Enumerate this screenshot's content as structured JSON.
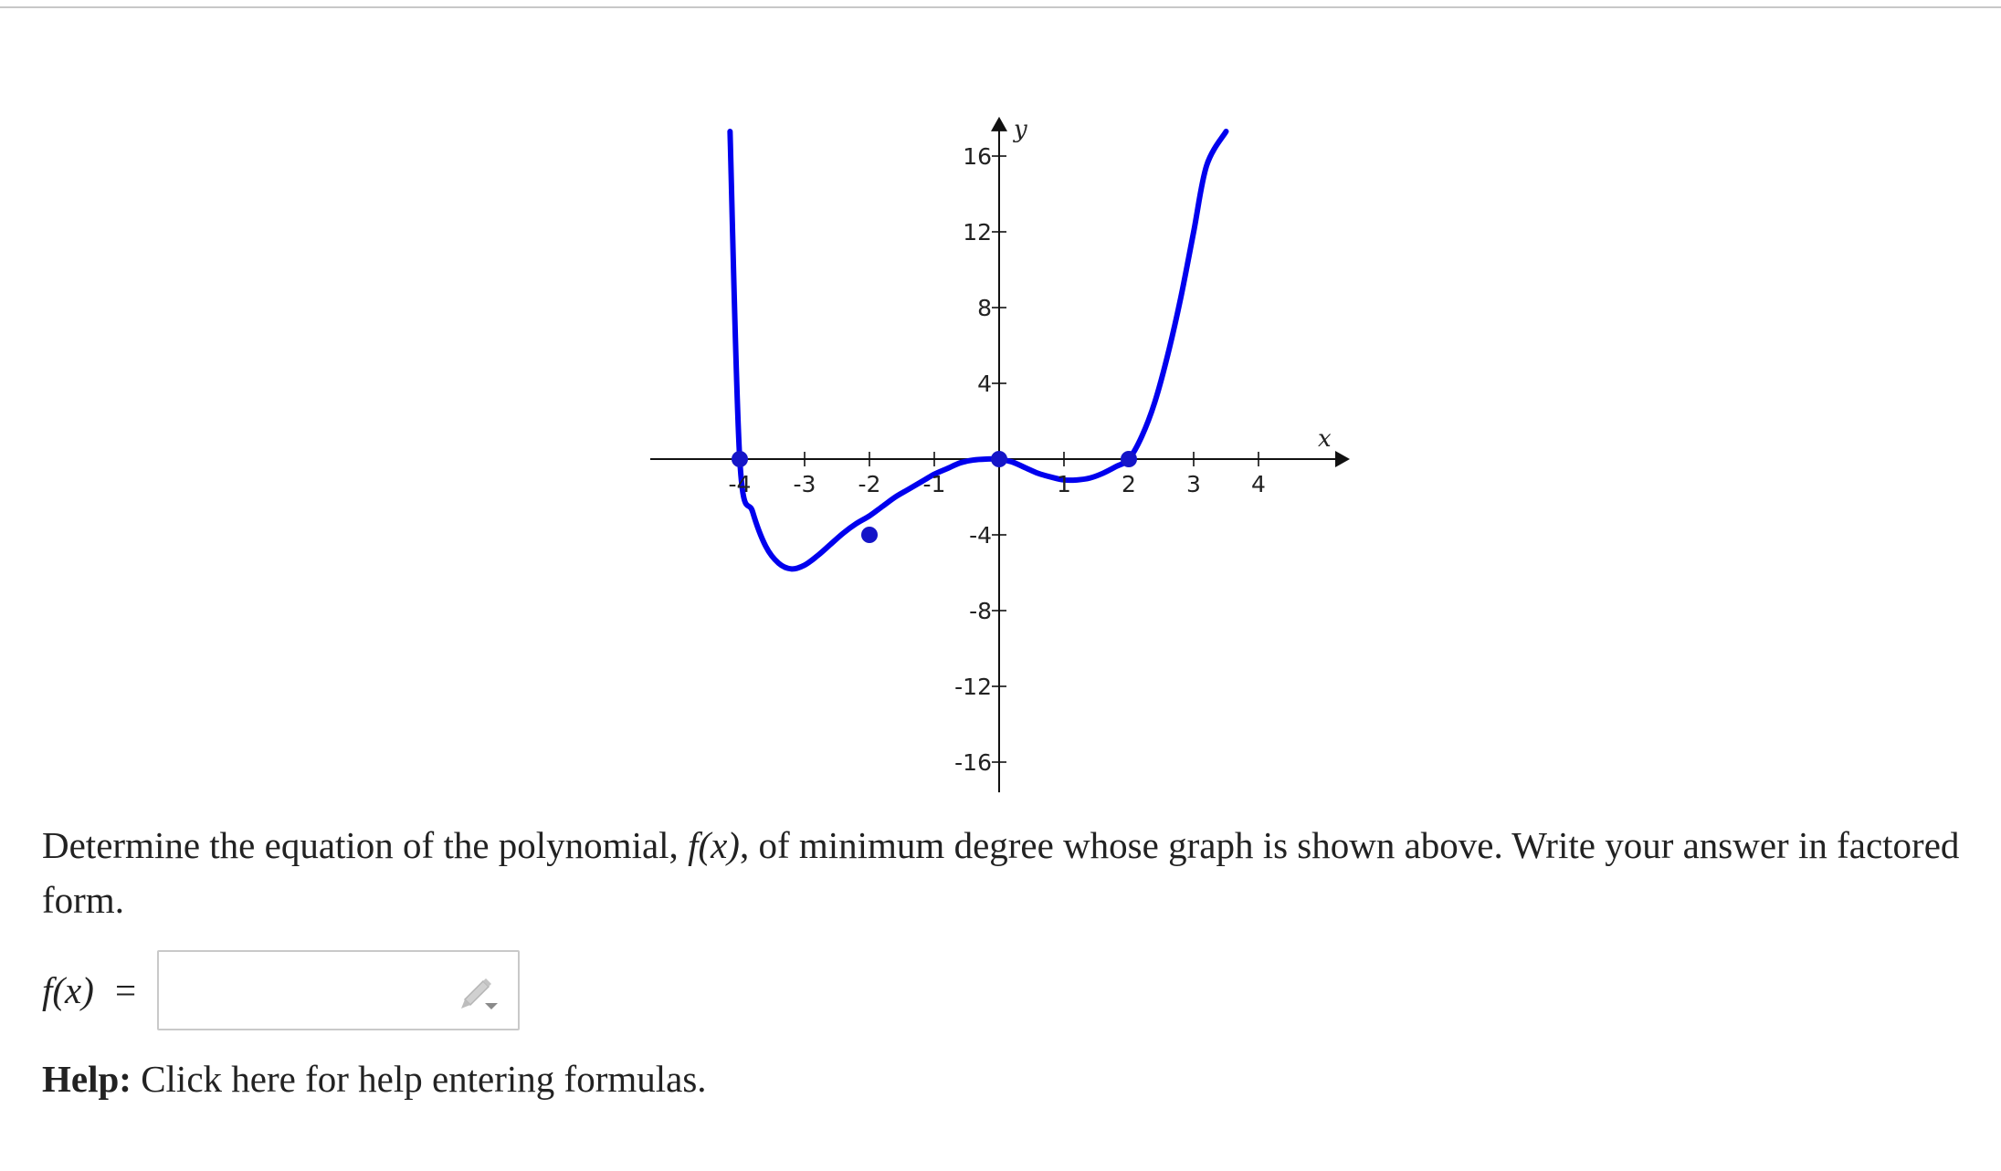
{
  "question": {
    "part1": "Determine the equation of the polynomial, ",
    "fx": "f(x)",
    "part2": ", of minimum degree whose graph is shown above. Write your answer in factored form."
  },
  "answer": {
    "label": "f(x)  =",
    "value": ""
  },
  "help": {
    "bold": "Help:",
    "link": " Click here for help entering formulas."
  },
  "icons": {
    "edit": "pencil-icon"
  },
  "colors": {
    "curve": "#0000ee",
    "point": "#1515c8",
    "axis": "#111111"
  },
  "chart_data": {
    "type": "line",
    "title": "",
    "xlabel": "x",
    "ylabel": "y",
    "xlim": [
      -5.0,
      5.0
    ],
    "ylim": [
      -17.5,
      17.5
    ],
    "x_ticks": [
      -4,
      -3,
      -2,
      -1,
      1,
      2,
      3,
      4
    ],
    "x_tick_labels": [
      "-4",
      "-3",
      "-2",
      "-1",
      "1",
      "2",
      "3",
      "4"
    ],
    "y_ticks": [
      16,
      12,
      8,
      4,
      -4,
      -8,
      -12,
      -16
    ],
    "y_tick_labels": [
      "16",
      "12",
      "8",
      "4",
      "-4",
      "-8",
      "-12",
      "-16"
    ],
    "grid": false,
    "series": [
      {
        "x": [
          -4.15,
          -4.0,
          -3.8,
          -3.6,
          -3.4,
          -3.2,
          -3.0,
          -2.8,
          -2.6,
          -2.4,
          -2.2,
          -2.0,
          -1.8,
          -1.6,
          -1.4,
          -1.2,
          -1.0,
          -0.8,
          -0.6,
          -0.4,
          -0.2,
          0.0,
          0.2,
          0.4,
          0.6,
          0.8,
          1.0,
          1.2,
          1.4,
          1.6,
          1.8,
          2.0,
          2.2,
          2.4,
          2.6,
          2.8,
          3.0,
          3.2,
          3.5
        ],
        "y": [
          17.3,
          0.0,
          -2.8,
          -4.6,
          -5.5,
          -5.8,
          -5.6,
          -5.1,
          -4.5,
          -3.9,
          -3.4,
          -3.0,
          -2.5,
          -2.0,
          -1.6,
          -1.2,
          -0.8,
          -0.5,
          -0.2,
          -0.05,
          0.0,
          0.0,
          -0.15,
          -0.45,
          -0.75,
          -0.95,
          -1.1,
          -1.1,
          -1.0,
          -0.75,
          -0.4,
          0.0,
          1.2,
          3.0,
          5.5,
          8.5,
          12.0,
          15.5,
          17.3
        ]
      }
    ],
    "points": [
      {
        "x": -4,
        "y": 0
      },
      {
        "x": -2,
        "y": -4
      },
      {
        "x": 0,
        "y": 0
      },
      {
        "x": 2,
        "y": 0
      }
    ]
  }
}
